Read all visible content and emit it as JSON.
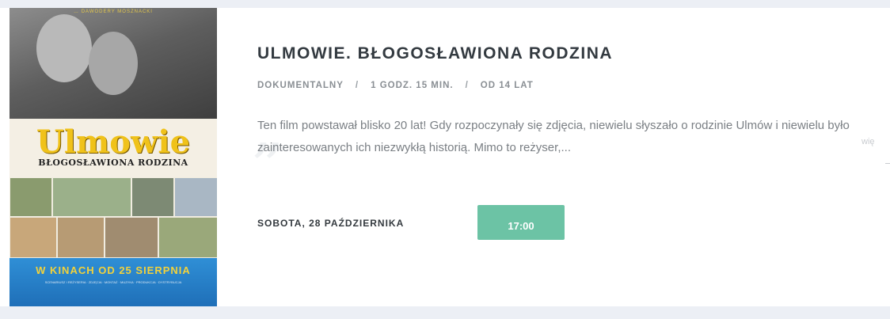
{
  "movie": {
    "title": "ULMOWIE. BŁOGOSŁAWIONA RODZINA",
    "genre": "DOKUMENTALNY",
    "duration": "1 GODZ. 15 MIN.",
    "age_rating": "OD 14 LAT",
    "meta_separator": "/",
    "description": "Ten film powstawał blisko 20 lat! Gdy rozpoczynały się zdjęcia, niewielu słyszało o rodzinie Ulmów i niewielu było zainteresowanych ich niezwykłą historią. Mimo to reżyser,...",
    "quote_mark": "„",
    "ghost_text": "wię"
  },
  "poster": {
    "top_credit": "… DAWODERY MOSZNACKI",
    "title": "Ulmowie",
    "subtitle": "BŁOGOSŁAWIONA RODZINA",
    "release": "W KINACH OD 25 SIERPNIA",
    "credits": "SCENARIUSZ I REŻYSERIA · ZDJĘCIA · MONTAŻ · MUZYKA · PRODUKCJA · DYSTRYBUCJA"
  },
  "showtimes": {
    "date": "SOBOTA, 28 PAŹDZIERNIKA",
    "times": [
      "17:00"
    ]
  },
  "colors": {
    "background": "#eceff5",
    "card": "#ffffff",
    "title": "#333a40",
    "meta": "#8a8f94",
    "description": "#7a7f84",
    "time_button": "#6cc3a5",
    "poster_title": "#f0c21a",
    "poster_release_band": "#2f8fd6"
  }
}
